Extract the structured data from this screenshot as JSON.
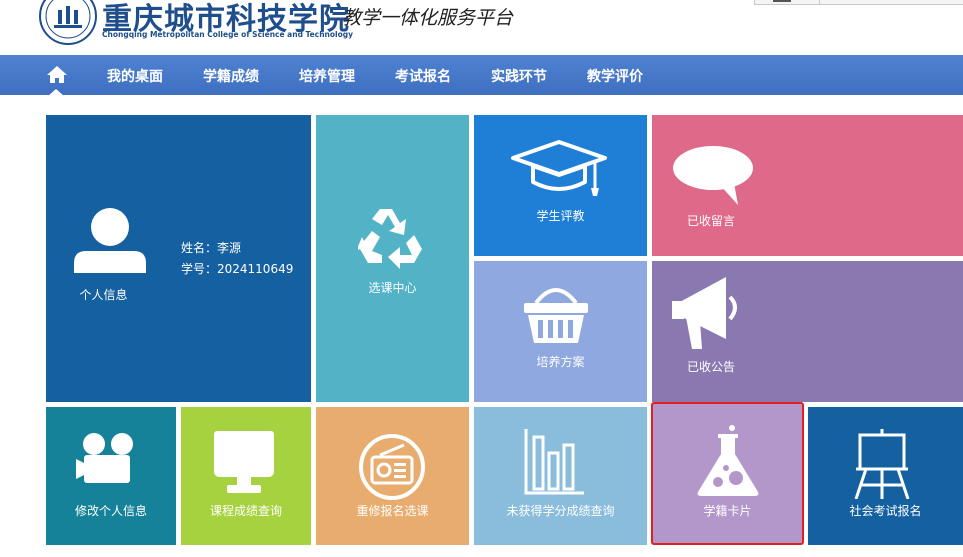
{
  "header": {
    "college_cn": "重庆城市科技学院",
    "college_en": "Chongqing Metropolitan College of Science and Technology",
    "platform_title": "教学一体化服务平台"
  },
  "nav": {
    "home_icon": "home-icon",
    "items": [
      "我的桌面",
      "学籍成绩",
      "培养管理",
      "考试报名",
      "实践环节",
      "教学评价"
    ]
  },
  "profile": {
    "label": "个人信息",
    "name_line": "姓名：李源",
    "id_line": "学号：2024110649"
  },
  "tiles": {
    "course_selection": "选课中心",
    "student_evaluation": "学生评教",
    "received_messages": "已收留言",
    "training_plan": "培养方案",
    "received_notices": "已收公告",
    "edit_profile": "修改个人信息",
    "grade_query": "课程成绩查询",
    "retake_registration": "重修报名选课",
    "uncredited_grades": "未获得学分成绩查询",
    "student_card": "学籍卡片",
    "social_exam_registration": "社会考试报名"
  },
  "colors": {
    "nav_blue": "#4677c8",
    "profile": "#1560a0",
    "course_selection": "#52b3c7",
    "student_evaluation": "#1f7fd6",
    "received_messages": "#de6988",
    "training_plan": "#8fa8e0",
    "received_notices": "#8a78b0",
    "edit_profile": "#16829a",
    "grade_query": "#a6d23f",
    "retake_registration": "#e8ad6e",
    "uncredited_grades": "#8abcdb",
    "student_card": "#b497ca",
    "social_exam_registration": "#1560a0",
    "highlight": "#e02020"
  }
}
